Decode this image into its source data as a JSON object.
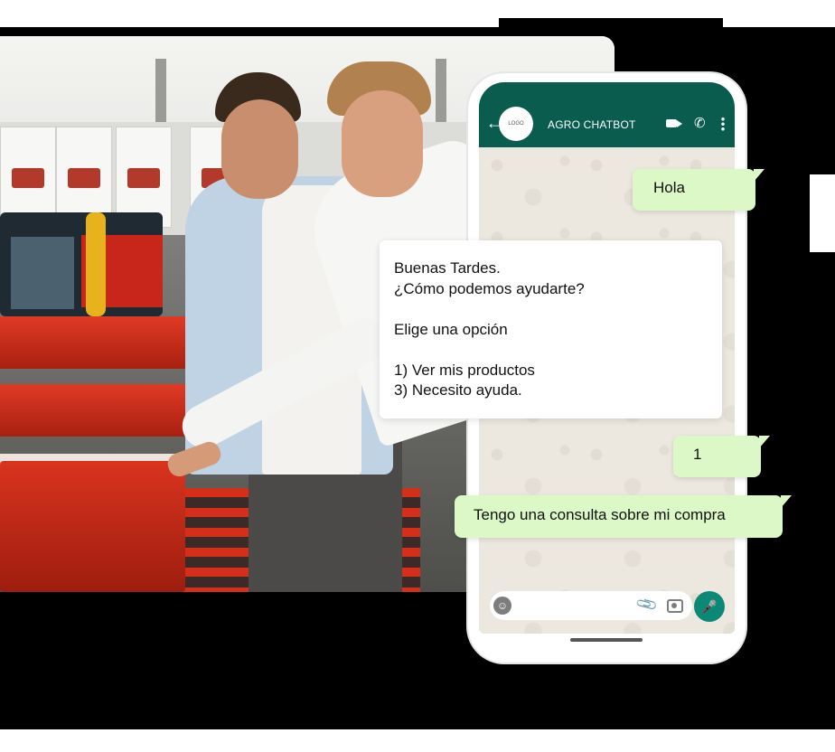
{
  "chat": {
    "title": "AGRO CHATBOT",
    "avatar_text": "LOGO",
    "messages": [
      {
        "from": "user",
        "text": "Hola"
      },
      {
        "from": "bot",
        "text": "Buenas Tardes.\n¿Cómo podemos ayudarte?\n\nElige una opción\n\n1) Ver mis productos\n3) Necesito ayuda."
      },
      {
        "from": "user",
        "text": "1"
      },
      {
        "from": "user",
        "text": "Tengo una consulta sobre mi compra"
      }
    ]
  },
  "icons": {
    "back": "arrow-left",
    "video": "video-camera",
    "call": "phone",
    "menu": "more-vertical",
    "emoji": "smiley",
    "attach": "paperclip",
    "camera": "camera",
    "mic": "microphone"
  },
  "colors": {
    "header": "#0a5c4f",
    "outgoing_bubble": "#dcf8c6",
    "incoming_bubble": "#ffffff",
    "mic_button": "#0a8a76"
  }
}
